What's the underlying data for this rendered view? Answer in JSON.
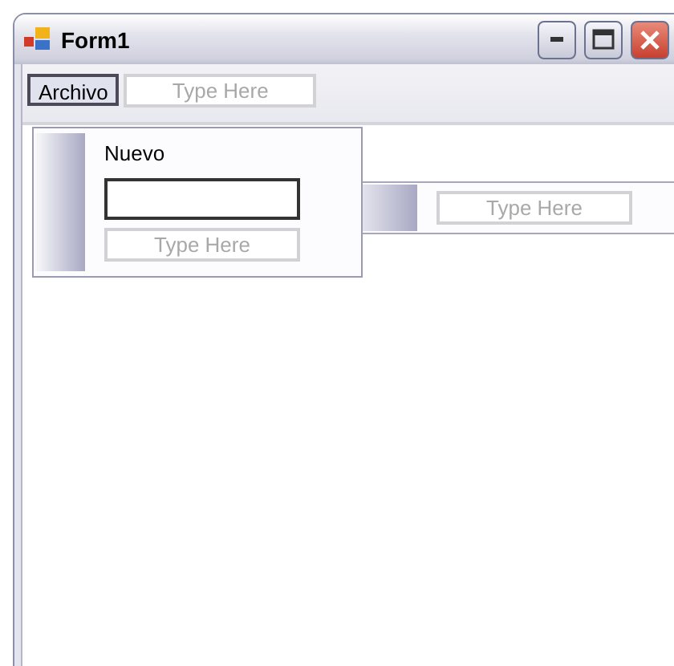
{
  "window": {
    "title": "Form1"
  },
  "menu_bar": {
    "items": [
      {
        "kind": "menu",
        "label": "Archivo",
        "selected": true
      },
      {
        "kind": "new",
        "label": "Type Here",
        "selected": false
      }
    ]
  },
  "dropdown": {
    "items": [
      {
        "kind": "item",
        "label": "Nuevo"
      },
      {
        "kind": "editing"
      },
      {
        "kind": "new",
        "label": "Type Here"
      }
    ]
  },
  "submenu": {
    "items": [
      {
        "kind": "new",
        "label": "Type Here"
      }
    ]
  }
}
